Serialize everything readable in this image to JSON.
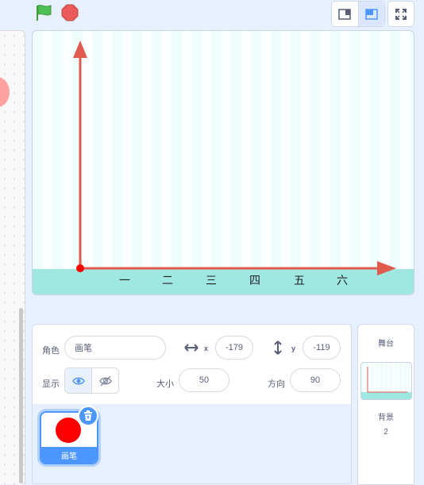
{
  "toolbar": {
    "green_flag_icon": "green-flag-icon",
    "stop_icon": "stop-icon",
    "small_stage_icon": "small-stage-icon",
    "large_stage_icon": "large-stage-icon",
    "fullscreen_icon": "fullscreen-icon"
  },
  "stage": {
    "x_labels": [
      "一",
      "二",
      "三",
      "四",
      "五",
      "六"
    ],
    "axis_color": "#e05a4d",
    "ground_color": "#9fe7e1"
  },
  "sprite_info": {
    "sprite_label": "角色",
    "sprite_name": "画笔",
    "x_label": "x",
    "x_value": "-179",
    "y_label": "y",
    "y_value": "-119",
    "show_label": "显示",
    "size_label": "大小",
    "size_value": "50",
    "direction_label": "方向",
    "direction_value": "90"
  },
  "sprites": [
    {
      "name": "画笔",
      "color": "#ff0000"
    }
  ],
  "stage_pane": {
    "title": "舞台",
    "backdrops_label": "背景",
    "backdrops_count": "2"
  },
  "colors": {
    "accent": "#4c97ff",
    "flag_green": "#4cbf56",
    "stop_red": "#ec5959"
  }
}
